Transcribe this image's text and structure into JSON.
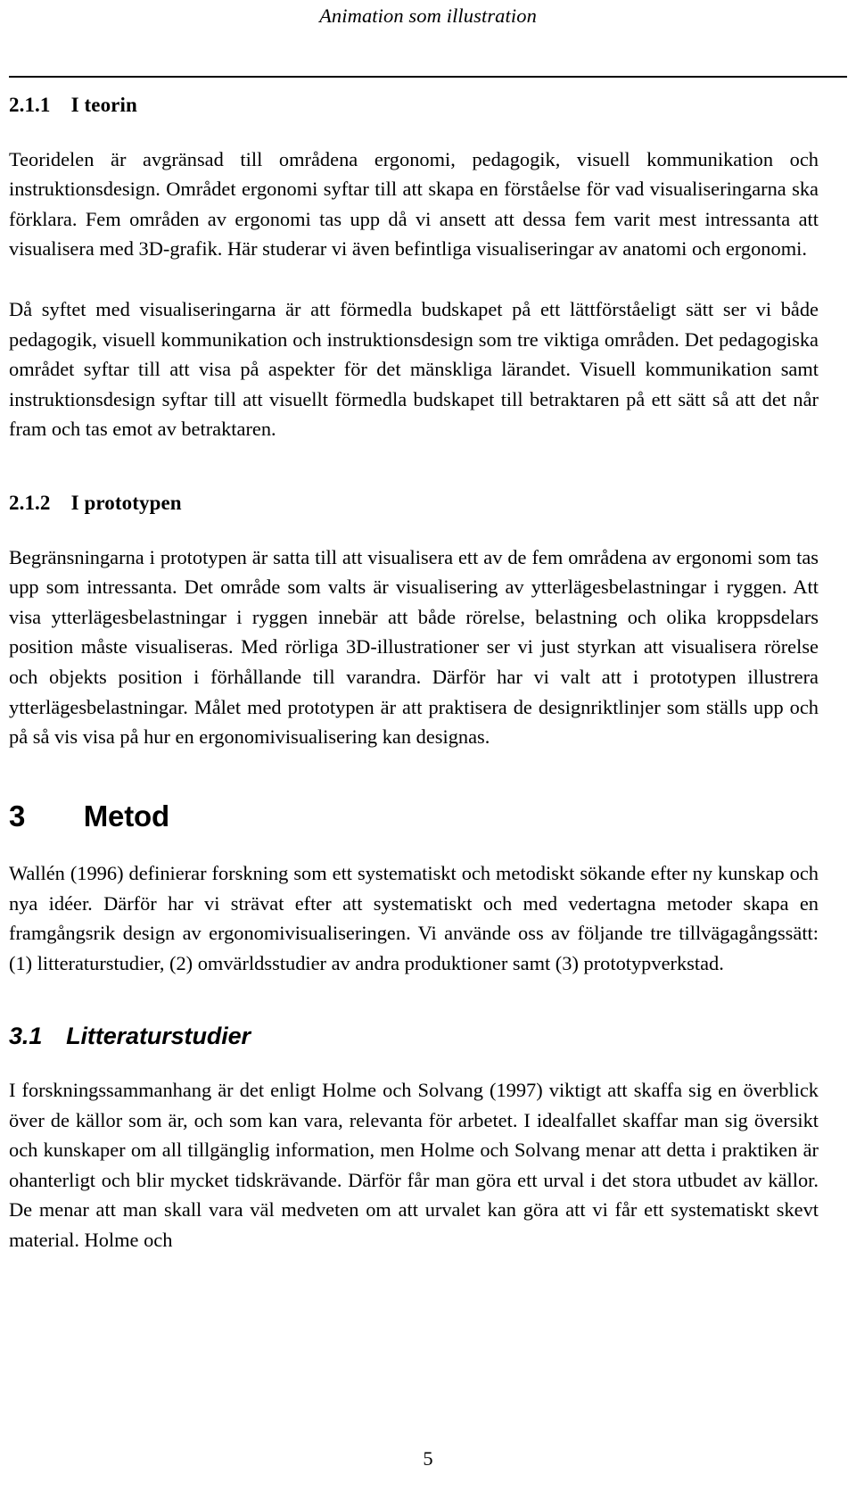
{
  "document": {
    "running_header": "Animation som illustration",
    "page_number": "5"
  },
  "sections": {
    "teorin": {
      "number": "2.1.1",
      "title": "I teorin",
      "heading_full": "2.1.1 I teorin",
      "paragraphs": [
        "Teoridelen är avgränsad till områdena ergonomi, pedagogik, visuell kommunikation och instruktionsdesign. Området ergonomi syftar till att skapa en förståelse för vad visualiseringarna ska förklara. Fem områden av ergonomi tas upp då vi ansett att dessa fem varit mest intressanta att visualisera med 3D-grafik. Här studerar vi även befintliga visualiseringar av anatomi och ergonomi.",
        "Då syftet med visualiseringarna är att förmedla budskapet på ett lättförståeligt sätt ser vi både pedagogik, visuell kommunikation och instruktionsdesign som tre viktiga områden. Det pedagogiska området syftar till att visa på aspekter för det mänskliga lärandet. Visuell kommunikation samt instruktionsdesign syftar till att visuellt förmedla budskapet till betraktaren på ett sätt så att det når fram och tas emot av betraktaren."
      ]
    },
    "prototypen": {
      "number": "2.1.2",
      "title": "I prototypen",
      "heading_full": "2.1.2 I prototypen",
      "paragraphs": [
        "Begränsningarna i prototypen är satta till att visualisera ett av de fem områdena av ergonomi som tas upp som intressanta. Det område som valts är visualisering av ytterlägesbelastningar i ryggen. Att visa ytterlägesbelastningar i ryggen innebär att både rörelse, belastning och olika kroppsdelars position måste visualiseras. Med rörliga 3D-illustrationer ser vi just styrkan att visualisera rörelse och objekts position i förhållande till varandra. Därför har vi valt att i prototypen illustrera ytterlägesbelastningar. Målet med prototypen är att praktisera de designriktlinjer som ställs upp och på så vis visa på hur en ergonomivisualisering kan designas."
      ]
    },
    "metod": {
      "number": "3",
      "title": "Metod",
      "heading_full": "3  Metod",
      "paragraphs": [
        "Wallén (1996) definierar forskning som ett systematiskt och metodiskt sökande efter ny kunskap och nya idéer. Därför har vi strävat efter att systematiskt och med vedertagna metoder skapa en framgångsrik design av ergonomivisualiseringen. Vi använde oss av följande tre tillvägagångssätt: (1) litteraturstudier, (2) omvärldsstudier av andra produktioner samt (3) prototypverkstad."
      ]
    },
    "litteraturstudier": {
      "number": "3.1",
      "title": "Litteraturstudier",
      "heading_full": "3.1 Litteraturstudier",
      "paragraphs": [
        "I forskningssammanhang är det enligt Holme och Solvang (1997) viktigt att skaffa sig en överblick över de källor som är, och som kan vara, relevanta för arbetet. I idealfallet skaffar man sig översikt och kunskaper om all tillgänglig information, men Holme och Solvang menar att detta i praktiken är ohanterligt och blir mycket tidskrävande. Därför får man göra ett urval i det stora utbudet av källor. De menar att man skall vara väl medveten om att urvalet kan göra att vi får ett systematiskt skevt material. Holme och"
      ]
    }
  },
  "colors": {
    "text": "#000000",
    "background": "#ffffff",
    "rule": "#000000"
  }
}
